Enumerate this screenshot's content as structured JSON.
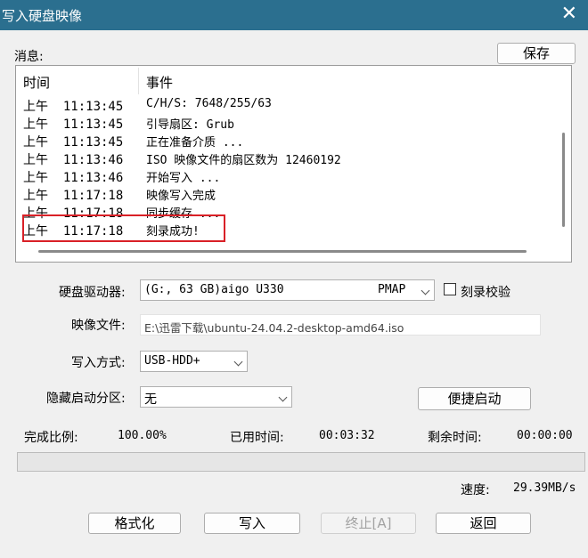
{
  "window": {
    "title": "写入硬盘映像",
    "close_glyph": "✕"
  },
  "messages": {
    "label": "消息:",
    "save_label": "保存",
    "columns": {
      "time": "时间",
      "event": "事件"
    },
    "rows": [
      {
        "ampm": "上午",
        "clock": "11:13:45",
        "event": "C/H/S: 7648/255/63"
      },
      {
        "ampm": "上午",
        "clock": "11:13:45",
        "event": "引导扇区: Grub"
      },
      {
        "ampm": "上午",
        "clock": "11:13:45",
        "event": "正在准备介质 ..."
      },
      {
        "ampm": "上午",
        "clock": "11:13:46",
        "event": "ISO 映像文件的扇区数为 12460192"
      },
      {
        "ampm": "上午",
        "clock": "11:13:46",
        "event": "开始写入 ..."
      },
      {
        "ampm": "上午",
        "clock": "11:17:18",
        "event": "映像写入完成"
      },
      {
        "ampm": "上午",
        "clock": "11:17:18",
        "event": "同步缓存 ..."
      },
      {
        "ampm": "上午",
        "clock": "11:17:18",
        "event": "刻录成功!"
      }
    ]
  },
  "drive": {
    "label": "硬盘驱动器:",
    "value": "(G:, 63 GB)aigo    U330",
    "value_tail": "PMAP",
    "verify_label": "刻录校验"
  },
  "image_file": {
    "label": "映像文件:",
    "value": "E:\\迅雷下载\\ubuntu-24.04.2-desktop-amd64.iso"
  },
  "write_method": {
    "label": "写入方式:",
    "value": "USB-HDD+"
  },
  "hidden_partition": {
    "label": "隐藏启动分区:",
    "value": "无"
  },
  "quick_start_label": "便捷启动",
  "status": {
    "completion_label": "完成比例:",
    "completion_value": "100.00%",
    "elapsed_label": "已用时间:",
    "elapsed_value": "00:03:32",
    "remaining_label": "剩余时间:",
    "remaining_value": "00:00:00",
    "speed_label": "速度:",
    "speed_value": "29.39MB/s",
    "progress": 1.0
  },
  "buttons": {
    "format": "格式化",
    "write": "写入",
    "abort": "终止[A]",
    "back": "返回"
  }
}
